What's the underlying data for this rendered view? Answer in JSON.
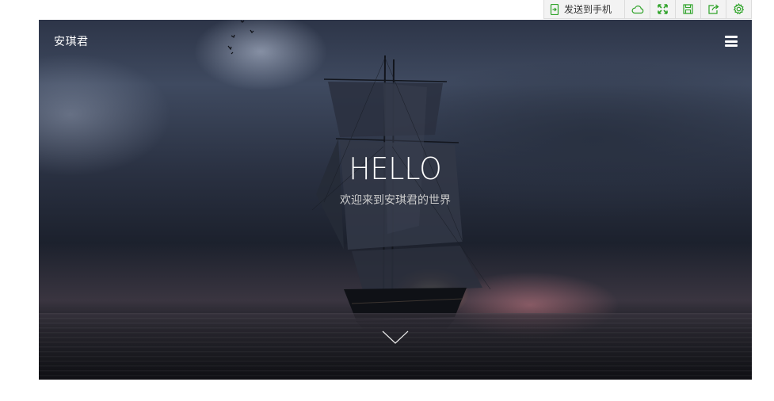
{
  "toolbar": {
    "send_to_phone_label": "发送到手机",
    "icons": [
      "send-to-phone-icon",
      "cloud-icon",
      "fullscreen-icon",
      "save-icon",
      "share-icon",
      "settings-icon"
    ],
    "icon_color": "#2fa329"
  },
  "hero": {
    "brand": "安琪君",
    "title": "HELLO",
    "subtitle": "欢迎来到安琪君的世界",
    "menu_icon": "hamburger-menu-icon",
    "scroll_icon": "chevron-down-icon"
  }
}
